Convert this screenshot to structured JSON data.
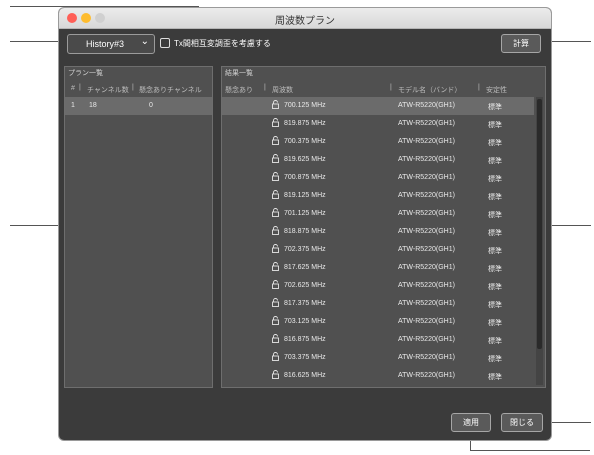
{
  "window": {
    "title": "周波数プラン"
  },
  "toolbar": {
    "history_value": "History#3",
    "tx_checkbox_label": "Tx間相互変調歪を考慮する",
    "tx_checked": false,
    "calculate_label": "計算"
  },
  "plan_list": {
    "title": "プラン一覧",
    "columns": [
      "#",
      "チャンネル数",
      "懸念ありチャンネル"
    ],
    "rows": [
      {
        "num": "1",
        "channels": "18",
        "concern": "0"
      }
    ]
  },
  "results": {
    "title": "結果一覧",
    "columns": [
      "懸念あり",
      "周波数",
      "モデル名（バンド）",
      "安定性"
    ],
    "rows": [
      {
        "freq": "700.125 MHz",
        "model": "ATW-R5220(GH1)",
        "stability": "標準"
      },
      {
        "freq": "819.875 MHz",
        "model": "ATW-R5220(GH1)",
        "stability": "標準"
      },
      {
        "freq": "700.375 MHz",
        "model": "ATW-R5220(GH1)",
        "stability": "標準"
      },
      {
        "freq": "819.625 MHz",
        "model": "ATW-R5220(GH1)",
        "stability": "標準"
      },
      {
        "freq": "700.875 MHz",
        "model": "ATW-R5220(GH1)",
        "stability": "標準"
      },
      {
        "freq": "819.125 MHz",
        "model": "ATW-R5220(GH1)",
        "stability": "標準"
      },
      {
        "freq": "701.125 MHz",
        "model": "ATW-R5220(GH1)",
        "stability": "標準"
      },
      {
        "freq": "818.875 MHz",
        "model": "ATW-R5220(GH1)",
        "stability": "標準"
      },
      {
        "freq": "702.375 MHz",
        "model": "ATW-R5220(GH1)",
        "stability": "標準"
      },
      {
        "freq": "817.625 MHz",
        "model": "ATW-R5220(GH1)",
        "stability": "標準"
      },
      {
        "freq": "702.625 MHz",
        "model": "ATW-R5220(GH1)",
        "stability": "標準"
      },
      {
        "freq": "817.375 MHz",
        "model": "ATW-R5220(GH1)",
        "stability": "標準"
      },
      {
        "freq": "703.125 MHz",
        "model": "ATW-R5220(GH1)",
        "stability": "標準"
      },
      {
        "freq": "816.875 MHz",
        "model": "ATW-R5220(GH1)",
        "stability": "標準"
      },
      {
        "freq": "703.375 MHz",
        "model": "ATW-R5220(GH1)",
        "stability": "標準"
      },
      {
        "freq": "816.625 MHz",
        "model": "ATW-R5220(GH1)",
        "stability": "標準"
      }
    ],
    "lock_icon": "lock-icon"
  },
  "footer": {
    "apply_label": "適用",
    "close_label": "閉じる"
  },
  "colors": {
    "window_bg": "#3b3b3b",
    "panel_bg": "#505050",
    "selected_row": "#6b6b6b",
    "close": "#ff5f57",
    "minimize": "#febc2e",
    "zoom": "#d0d0d0"
  }
}
